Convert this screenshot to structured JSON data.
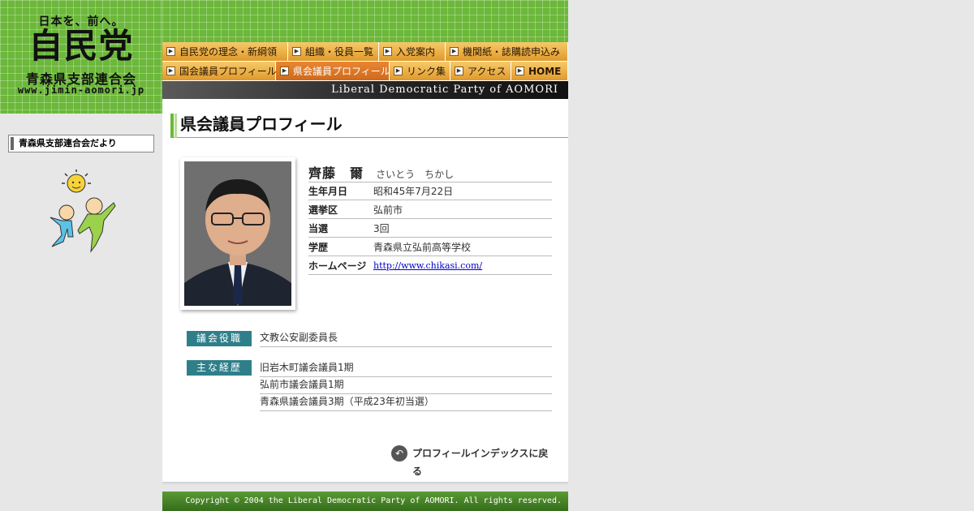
{
  "header": {
    "slogan": "日本を、前へ。",
    "party_name": "自民党",
    "branch_name": "青森県支部連合会",
    "url_text": "www.jimin-aomori.jp",
    "english_banner": "Liberal Democratic Party of AOMORI",
    "brand_green": "#6cb83a"
  },
  "nav": {
    "row1": [
      {
        "label": "自民党の理念・新綱領"
      },
      {
        "label": "組織・役員一覧"
      },
      {
        "label": "入党案内"
      },
      {
        "label": "機関紙・誌購読申込み"
      }
    ],
    "row2": [
      {
        "label": "国会議員プロフィール"
      },
      {
        "label": "県会議員プロフィール",
        "active": true
      },
      {
        "label": "リンク集"
      },
      {
        "label": "アクセス"
      },
      {
        "label": "HOME"
      }
    ]
  },
  "sidebar": {
    "news_link": "青森県支部連合会だより"
  },
  "main": {
    "page_title": "県会議員プロフィール",
    "member": {
      "name": "齊藤　爾",
      "kana": "さいとう　ちかし",
      "rows": [
        {
          "label": "生年月日",
          "value": "昭和45年7月22日"
        },
        {
          "label": "選挙区",
          "value": "弘前市"
        },
        {
          "label": "当選",
          "value": "3回"
        },
        {
          "label": "学歴",
          "value": "青森県立弘前高等学校"
        },
        {
          "label": "ホームページ",
          "value": "http://www.chikasi.com/"
        }
      ]
    },
    "council_role": {
      "label": "議会役職",
      "items": [
        "文教公安副委員長"
      ]
    },
    "career": {
      "label": "主な経歴",
      "items": [
        "旧岩木町議会議員1期",
        "弘前市議会議員1期",
        "青森県議会議員3期（平成23年初当選）"
      ]
    },
    "back_link": "プロフィールインデックスに戻る"
  },
  "footer": {
    "copyright": "Copyright © 2004 the Liberal Democratic Party of AOMORI. All rights reserved."
  }
}
